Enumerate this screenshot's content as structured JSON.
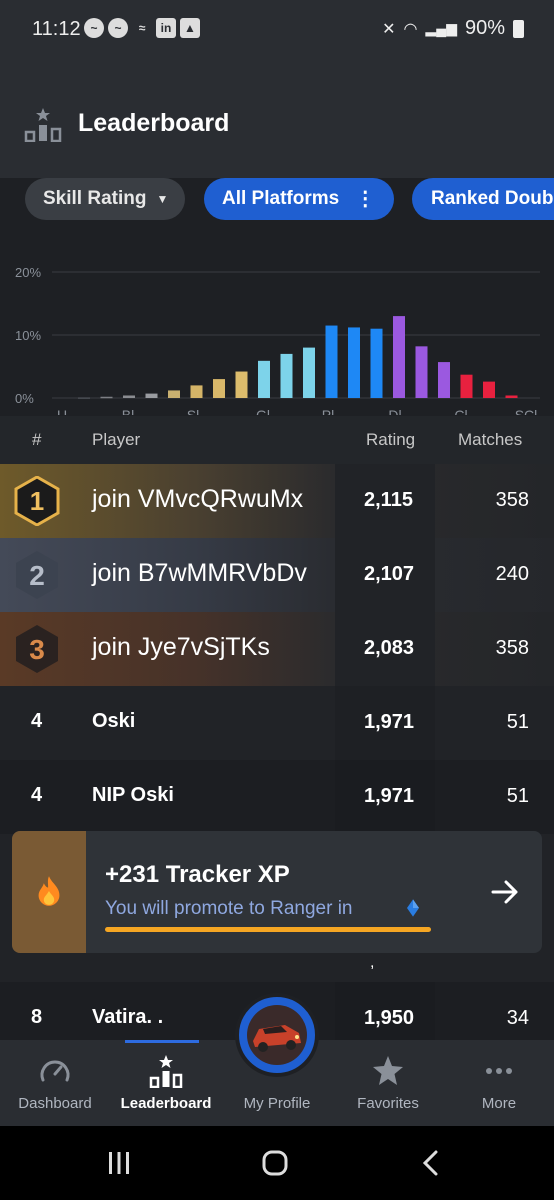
{
  "status": {
    "time": "11:12",
    "battery": "90%"
  },
  "header": {
    "title": "Leaderboard"
  },
  "filters": {
    "skill": "Skill Rating",
    "platform": "All Platforms",
    "playlist": "Ranked Doub"
  },
  "chart_data": {
    "type": "bar",
    "yticks": [
      "20%",
      "10%",
      "0%"
    ],
    "ylim": [
      0,
      20
    ],
    "categories": [
      "U",
      "Br",
      "Si",
      "Go",
      "Pl",
      "Di",
      "Ch",
      "GC",
      "SSL"
    ],
    "category_labels_visible": [
      "U",
      "Bl",
      "Sl",
      "Gl",
      "Pl",
      "Dl",
      "Cl",
      "SCl"
    ],
    "values": [
      0.1,
      0.2,
      0.4,
      0.7,
      1.2,
      2.0,
      3.0,
      4.2,
      5.9,
      7.0,
      8.0,
      11.5,
      11.2,
      11.0,
      13.0,
      8.2,
      5.7,
      3.7,
      2.6,
      0.4
    ],
    "bar_colors": [
      "#4a4e55",
      "#7d7f84",
      "#8a8c91",
      "#9a9ca1",
      "#c9b070",
      "#d4b468",
      "#d9b86a",
      "#dcbc6c",
      "#7dd3ea",
      "#7dd3ea",
      "#7dd3ea",
      "#1e88f5",
      "#1e88f5",
      "#1e88f5",
      "#9b59e0",
      "#9b59e0",
      "#9b59e0",
      "#e8213f",
      "#e8213f",
      "#e8213f"
    ]
  },
  "table": {
    "headers": {
      "rank": "#",
      "player": "Player",
      "rating": "Rating",
      "matches": "Matches"
    },
    "rows": [
      {
        "rank": "1",
        "player": "join VMvcQRwuMx",
        "rating": "2,115",
        "matches": "358"
      },
      {
        "rank": "2",
        "player": "join B7wMMRVbDv",
        "rating": "2,107",
        "matches": "240"
      },
      {
        "rank": "3",
        "player": "join Jye7vSjTKs",
        "rating": "2,083",
        "matches": "358"
      },
      {
        "rank": "4",
        "player": "Oski",
        "rating": "1,971",
        "matches": "51"
      },
      {
        "rank": "4",
        "player": "NIP Oski",
        "rating": "1,971",
        "matches": "51"
      },
      {
        "rank": "8",
        "player": "Vatira. .",
        "rating": "1,950",
        "matches": "34"
      }
    ]
  },
  "toast": {
    "title": "+231 Tracker XP",
    "subtitle": "You will promote to Ranger in",
    "progress": 1.0
  },
  "nav": {
    "dashboard": "Dashboard",
    "leaderboard": "Leaderboard",
    "profile": "My Profile",
    "favorites": "Favorites",
    "more": "More"
  }
}
